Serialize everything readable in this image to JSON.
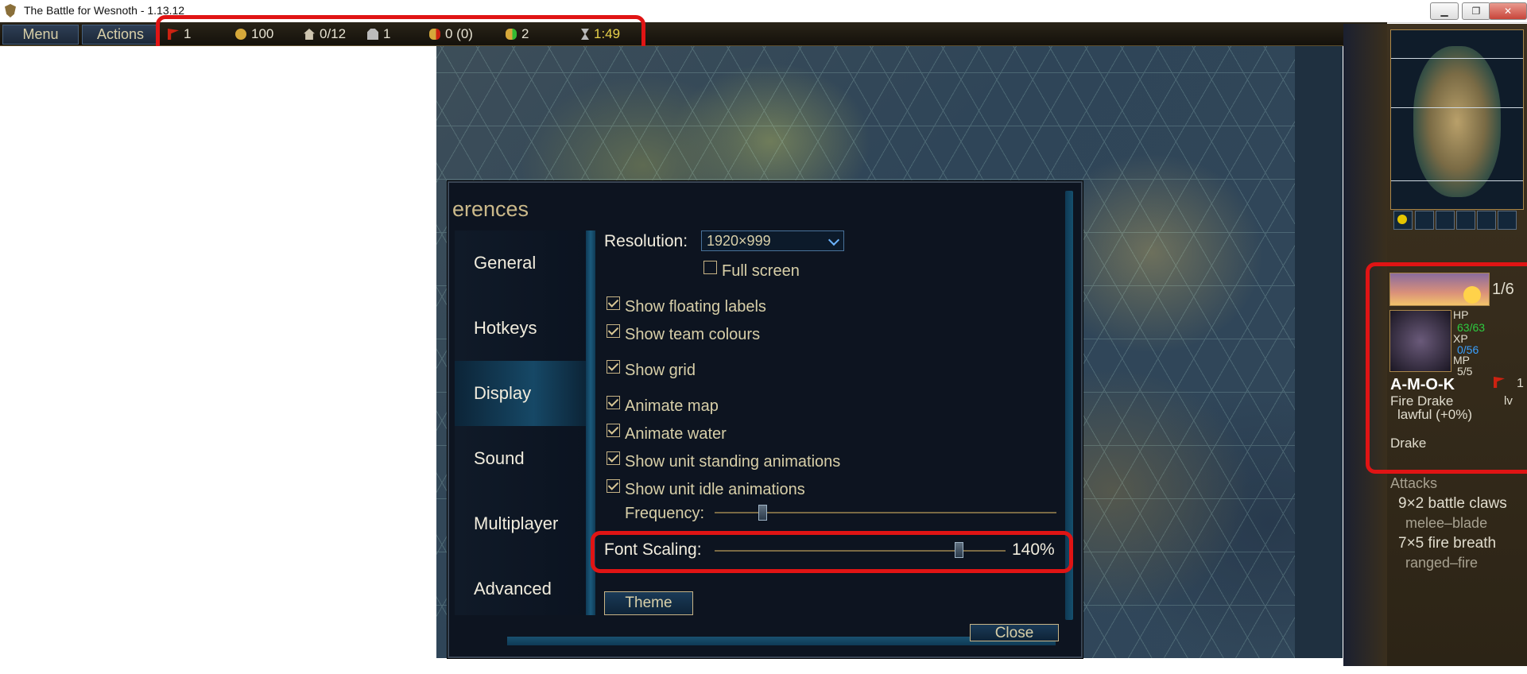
{
  "window": {
    "title": "The Battle for Wesnoth - 1.13.12",
    "minimize_label": "▁",
    "restore_label": "❐",
    "close_label": "✕"
  },
  "topbar": {
    "menu_label": "Menu",
    "actions_label": "Actions",
    "stats": {
      "turn_side": "1",
      "gold": "100",
      "villages": "0/12",
      "units": "1",
      "upkeep": "0 (0)",
      "income": "2",
      "time": "1:49"
    },
    "time_color": "#e8d24a"
  },
  "dialog": {
    "title": "erences",
    "sidebar": [
      {
        "label": "General"
      },
      {
        "label": "Hotkeys"
      },
      {
        "label": "Display"
      },
      {
        "label": "Sound"
      },
      {
        "label": "Multiplayer"
      },
      {
        "label": "Advanced"
      }
    ],
    "active_tab": "Display",
    "resolution_label": "Resolution:",
    "resolution_value": "1920×999",
    "fullscreen_label": "Full screen",
    "fullscreen_checked": false,
    "checks": [
      {
        "label": "Show floating labels",
        "checked": true
      },
      {
        "label": "Show team colours",
        "checked": true
      },
      {
        "label": "Show grid",
        "checked": true
      },
      {
        "label": "Animate map",
        "checked": true
      },
      {
        "label": "Animate water",
        "checked": true
      },
      {
        "label": "Show unit standing animations",
        "checked": true
      },
      {
        "label": "Show unit idle animations",
        "checked": true
      }
    ],
    "frequency_label": "Frequency:",
    "frequency_level": 0.14,
    "font_scaling_label": "Font Scaling:",
    "font_scaling_value": "140%",
    "font_scaling_level": 0.84,
    "theme_label": "Theme",
    "close_label": "Close"
  },
  "sidebar_right": {
    "turn_of_day": "1/6",
    "hp_label": "HP",
    "hp_value": "63/63",
    "xp_label": "XP",
    "xp_value": "0/56",
    "mp_label": "MP",
    "mp_value": "5/5",
    "unit_name": "A-M-O-K",
    "unit_type": "Fire Drake",
    "level_label": "lv",
    "side_number": "1",
    "alignment": "lawful (+0%)",
    "race": "Drake",
    "attacks_label": "Attacks",
    "attacks": [
      {
        "name": "9×2 battle claws",
        "type": "melee–blade"
      },
      {
        "name": "7×5 fire breath",
        "type": "ranged–fire"
      }
    ],
    "hp_color": "#2ecc40",
    "xp_color": "#3aa0ff"
  }
}
